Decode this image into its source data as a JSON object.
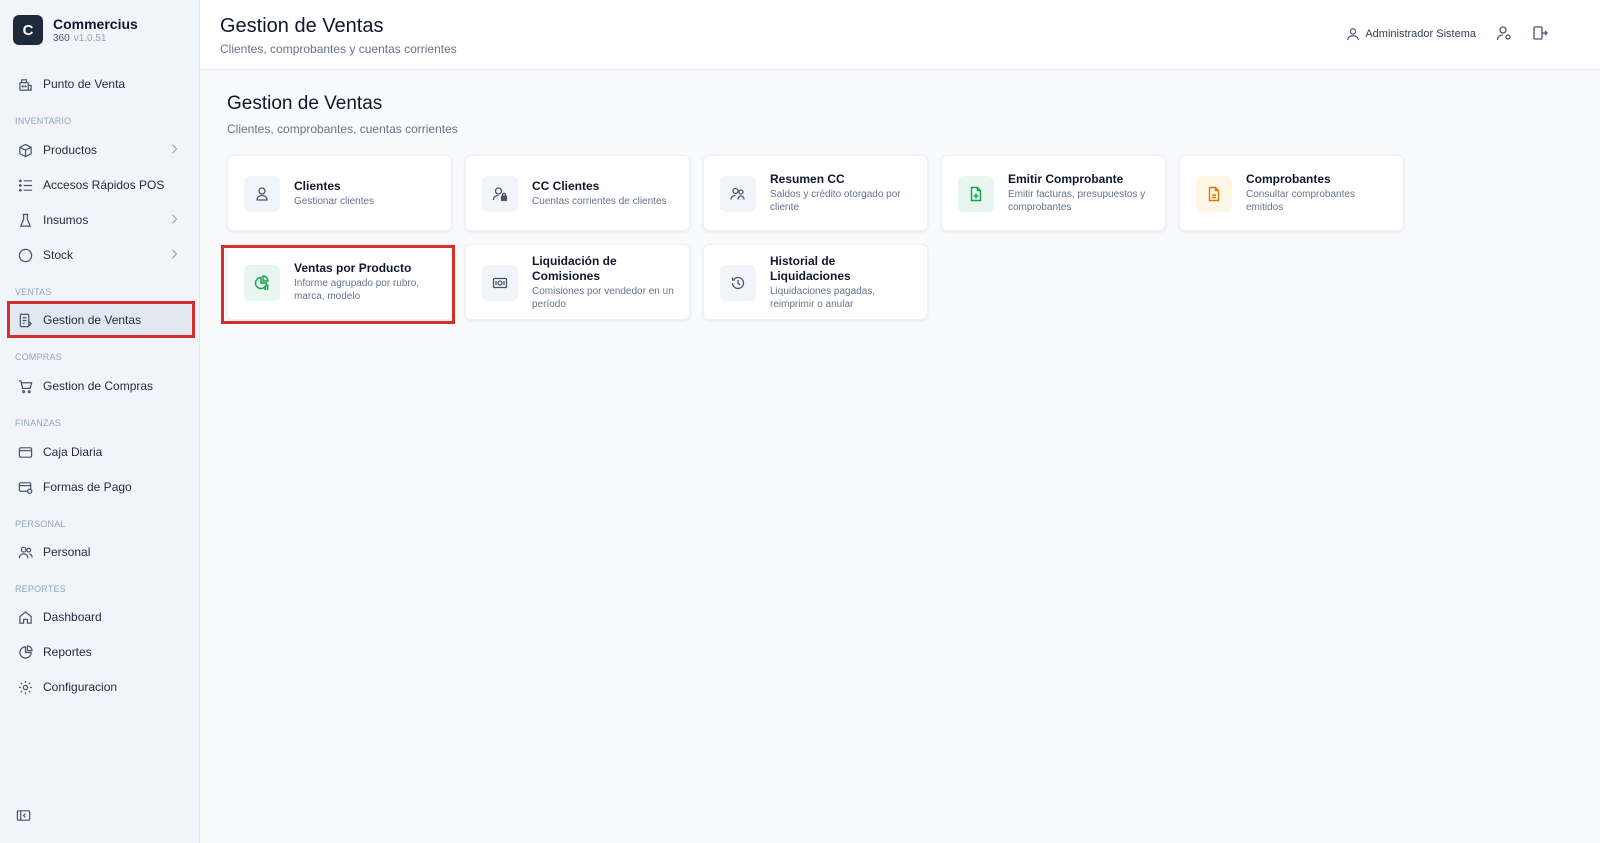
{
  "brand": {
    "logo_letter": "C",
    "name": "Commercius",
    "sub": "360",
    "version": "v1.0.51"
  },
  "sidebar": {
    "pos": "Punto de Venta",
    "sections": {
      "inventario": "INVENTARIO",
      "ventas": "VENTAS",
      "compras": "COMPRAS",
      "finanzas": "FINANZAS",
      "personal": "PERSONAL",
      "reportes": "REPORTES"
    },
    "items": {
      "productos": "Productos",
      "accesos": "Accesos Rápidos POS",
      "insumos": "Insumos",
      "stock": "Stock",
      "gestion_ventas": "Gestion de Ventas",
      "gestion_compras": "Gestion de Compras",
      "caja": "Caja Diaria",
      "formas_pago": "Formas de Pago",
      "personal": "Personal",
      "dashboard": "Dashboard",
      "reportes": "Reportes",
      "configuracion": "Configuracion"
    }
  },
  "header": {
    "title": "Gestion de Ventas",
    "subtitle": "Clientes, comprobantes y cuentas corrientes",
    "user": "Administrador Sistema"
  },
  "main": {
    "title": "Gestion de Ventas",
    "subtitle": "Clientes, comprobantes, cuentas corrientes",
    "cards": [
      {
        "title": "Clientes",
        "desc": "Gestionar clientes",
        "icon": "user-icon"
      },
      {
        "title": "CC Clientes",
        "desc": "Cuentas corrientes de clientes",
        "icon": "user-lock-icon"
      },
      {
        "title": "Resumen CC",
        "desc": "Saldos y crédito otorgado por cliente",
        "icon": "users-icon"
      },
      {
        "title": "Emitir Comprobante",
        "desc": "Emitir facturas, presupuestos y comprobantes",
        "icon": "file-plus-icon"
      },
      {
        "title": "Comprobantes",
        "desc": "Consultar comprobantes emitidos",
        "icon": "file-icon"
      },
      {
        "title": "Ventas por Producto",
        "desc": "Informe agrupado por rubro, marca, modelo",
        "icon": "chart-pie-icon"
      },
      {
        "title": "Liquidación de Comisiones",
        "desc": "Comisiones por vendedor en un período",
        "icon": "money-icon"
      },
      {
        "title": "Historial de Liquidaciones",
        "desc": "Liquidaciones pagadas, reimprimir o anular",
        "icon": "history-icon"
      }
    ]
  },
  "colors": {
    "highlight": "#d32f2f",
    "sidebar_bg": "#f1f5f9",
    "brand_dark": "#1e293b"
  }
}
